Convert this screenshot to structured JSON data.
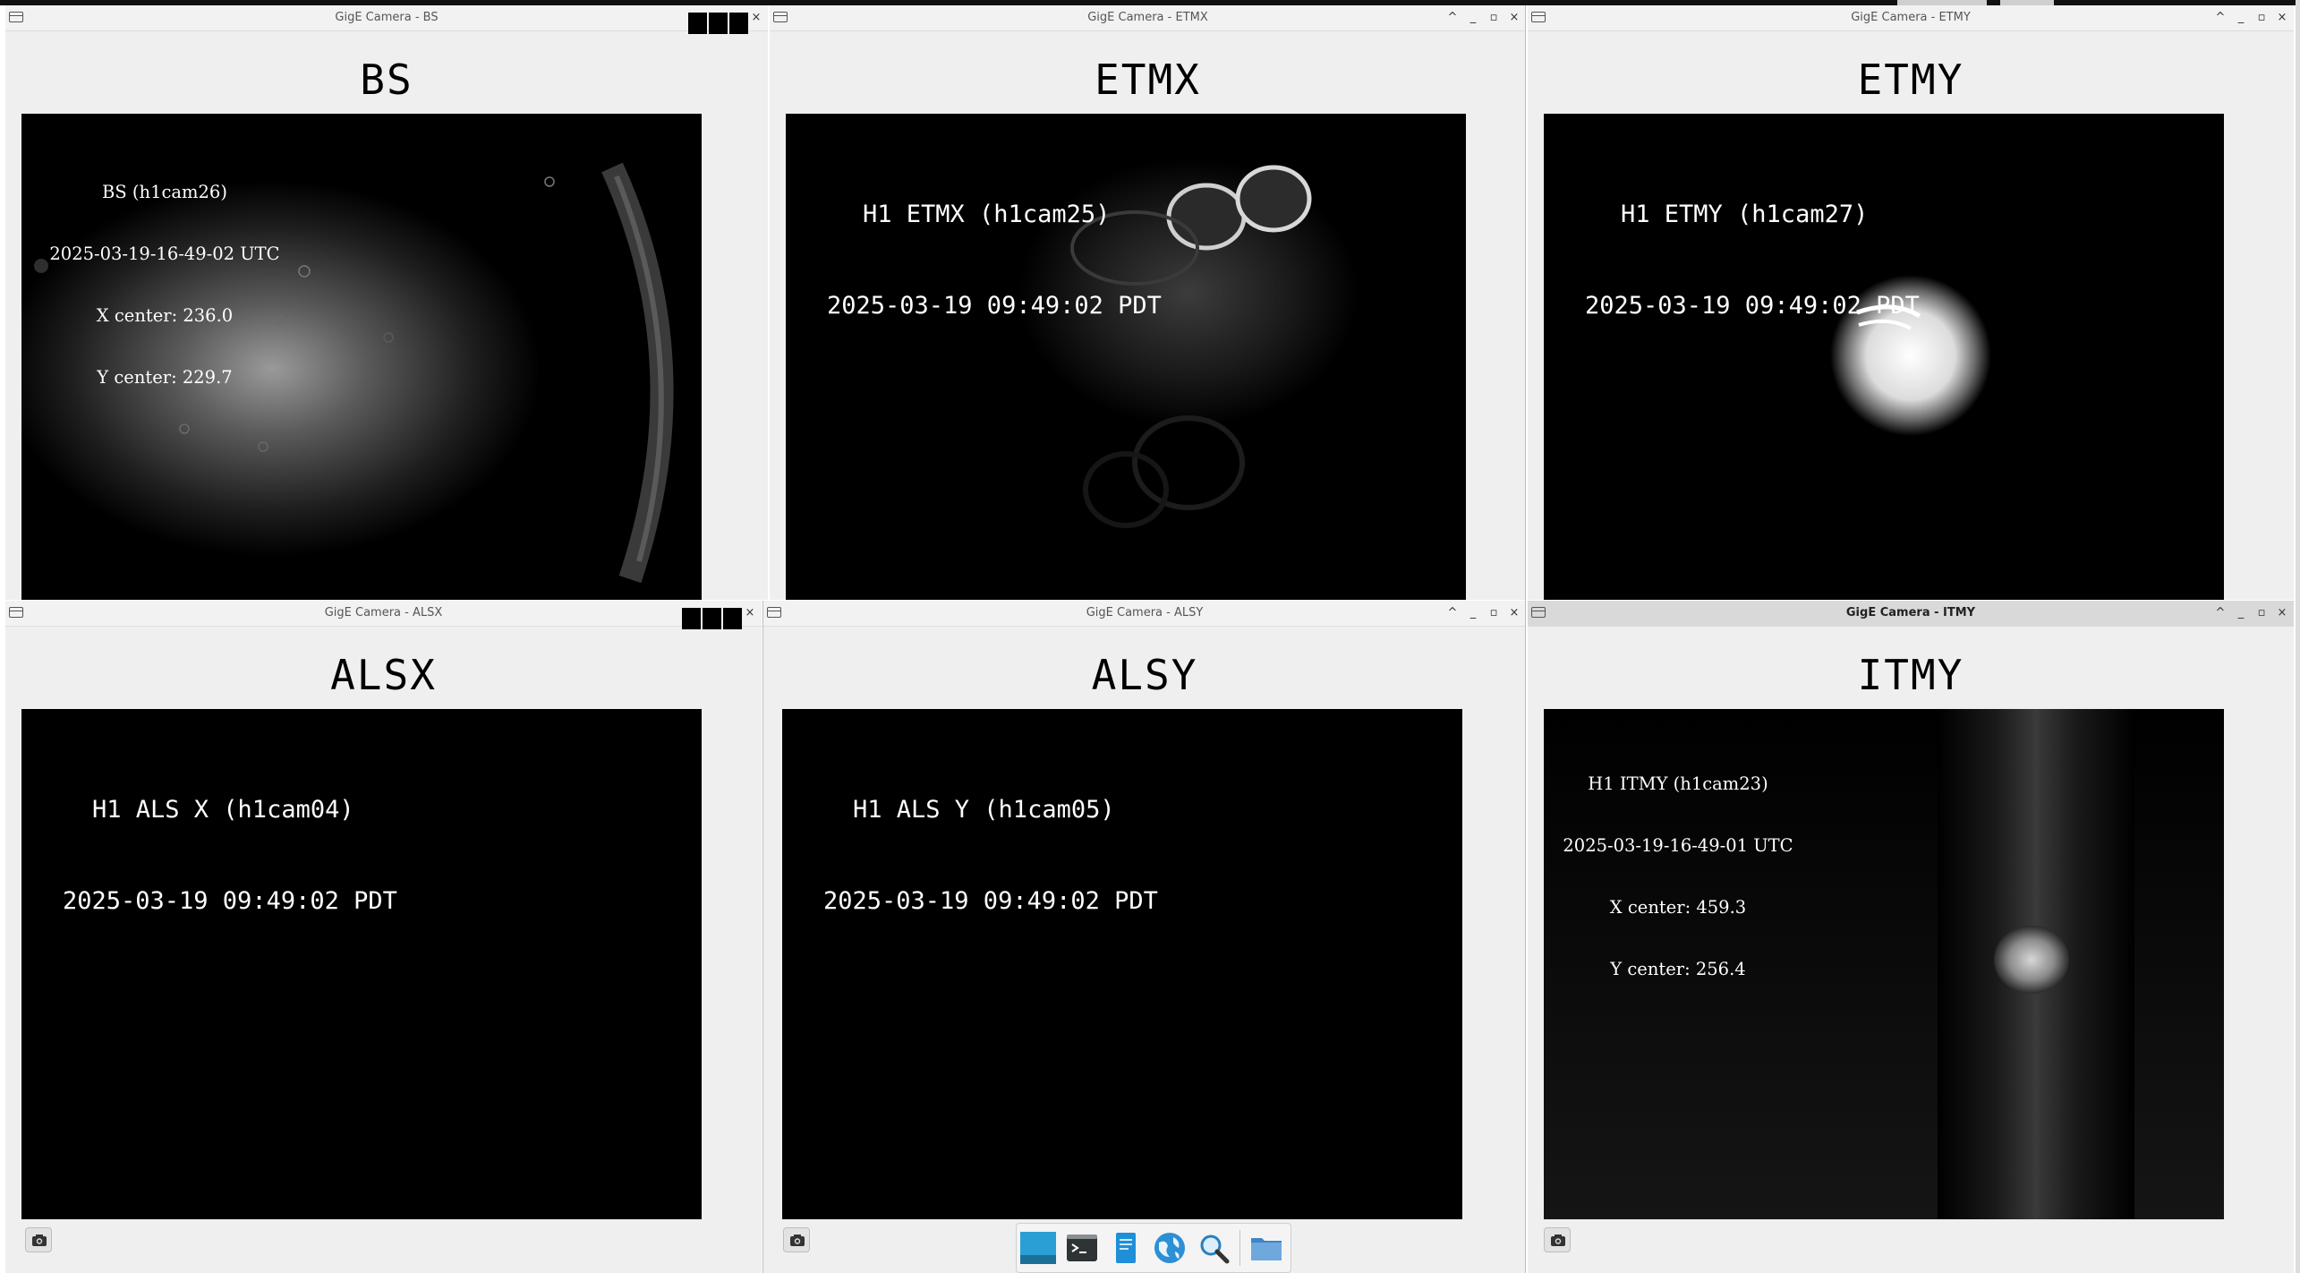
{
  "windows": [
    {
      "title": "GigE Camera - BS",
      "heading": "BS",
      "overlay_lines": [
        "BS (h1cam26)",
        "2025-03-19-16-49-02 UTC",
        "X center: 236.0",
        "Y center: 229.7"
      ]
    },
    {
      "title": "GigE Camera - ETMX",
      "heading": "ETMX",
      "overlay_lines": [
        "H1 ETMX (h1cam25)",
        "2025-03-19 09:49:02 PDT"
      ]
    },
    {
      "title": "GigE Camera - ETMY",
      "heading": "ETMY",
      "overlay_lines": [
        "H1 ETMY (h1cam27)",
        "2025-03-19 09:49:02 PDT"
      ]
    },
    {
      "title": "GigE Camera - ALSX",
      "heading": "ALSX",
      "overlay_lines": [
        "H1 ALS X (h1cam04)",
        "2025-03-19 09:49:02 PDT"
      ]
    },
    {
      "title": "GigE Camera - ALSY",
      "heading": "ALSY",
      "overlay_lines": [
        "H1 ALS Y (h1cam05)",
        "2025-03-19 09:49:02 PDT"
      ]
    },
    {
      "title": "GigE Camera - ITMY",
      "heading": "ITMY",
      "overlay_lines": [
        "H1 ITMY (h1cam23)",
        "2025-03-19-16-49-01 UTC",
        "X center: 459.3",
        "Y center: 256.4"
      ]
    }
  ],
  "window_controls": {
    "shade": "^",
    "minimize": "_",
    "maximize": "▫",
    "close": "×"
  },
  "snapshot_icon": "camera-icon",
  "taskbar": {
    "items": [
      "show-desktop-icon",
      "terminal-icon",
      "text-editor-icon",
      "web-browser-icon",
      "search-icon",
      "file-manager-icon"
    ]
  },
  "colors": {
    "window_bg": "#efefef",
    "feed_bg": "#000000",
    "overlay_text": "#ffffff",
    "active_titlebar": "#d9d9d9"
  }
}
